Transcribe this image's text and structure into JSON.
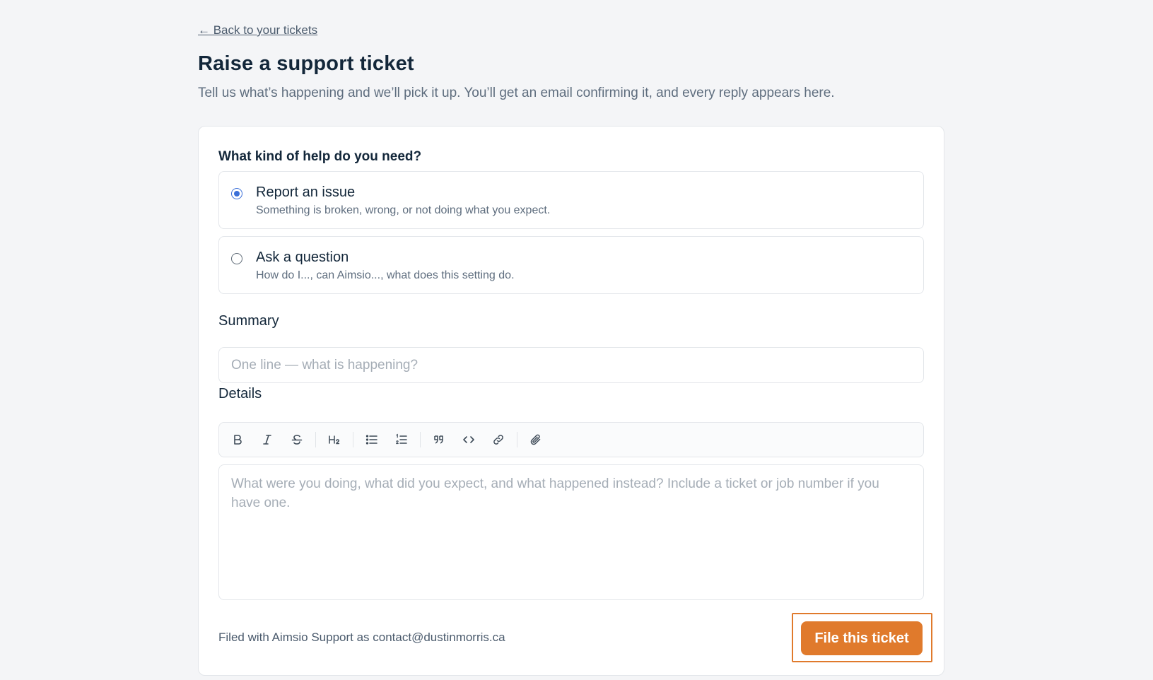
{
  "nav": {
    "back_label": "← Back to your tickets"
  },
  "header": {
    "title": "Raise a support ticket",
    "subtitle": "Tell us what’s happening and we’ll pick it up. You’ll get an email confirming it, and every reply appears here."
  },
  "form": {
    "help_type_label": "What kind of help do you need?",
    "options": [
      {
        "title": "Report an issue",
        "description": "Something is broken, wrong, or not doing what you expect.",
        "selected": true
      },
      {
        "title": "Ask a question",
        "description": "How do I..., can Aimsio..., what does this setting do.",
        "selected": false
      }
    ],
    "summary": {
      "label": "Summary",
      "placeholder": "One line — what is happening?",
      "value": ""
    },
    "details": {
      "label": "Details",
      "placeholder": "What were you doing, what did you expect, and what happened instead? Include a ticket or job number if you have one.",
      "value": "",
      "toolbar": [
        "bold-icon",
        "italic-icon",
        "strikethrough-icon",
        "heading-2-icon",
        "bullet-list-icon",
        "numbered-list-icon",
        "quote-icon",
        "code-icon",
        "link-icon",
        "attachment-icon"
      ]
    },
    "footer_note": "Filed with Aimsio Support as contact@dustinmorris.ca",
    "submit_label": "File this ticket"
  },
  "colors": {
    "accent": "#e07a2c",
    "radio_selected": "#3b6fd8",
    "background": "#f4f5f7"
  }
}
